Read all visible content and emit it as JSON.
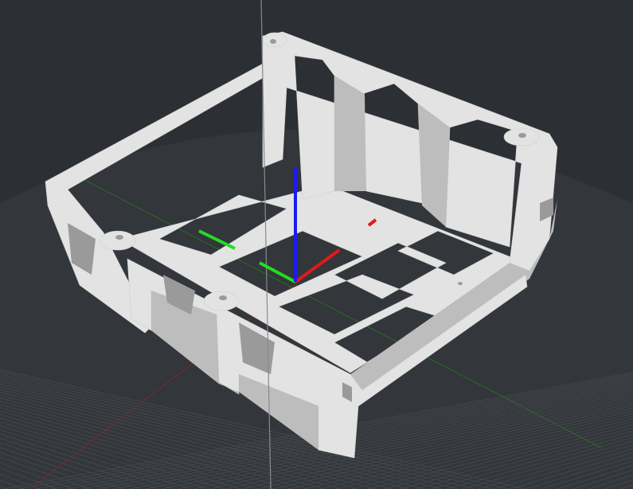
{
  "viewport": {
    "icon": "3d-viewport",
    "colors": {
      "background": "#2c2f33",
      "bed": "#33363a",
      "grid": "#474a4f",
      "model": "#e3e3e3",
      "model_shade": "#bdbdbd",
      "model_dark": "#9a9a9a",
      "axis_x": "#e01b1b",
      "axis_y": "#22dd22",
      "axis_z": "#1c1cf0",
      "axis_x_dim": "#7a2a2a",
      "axis_y_dim": "#2a6a2a",
      "vertical_guide": "#8a8a8a"
    }
  }
}
